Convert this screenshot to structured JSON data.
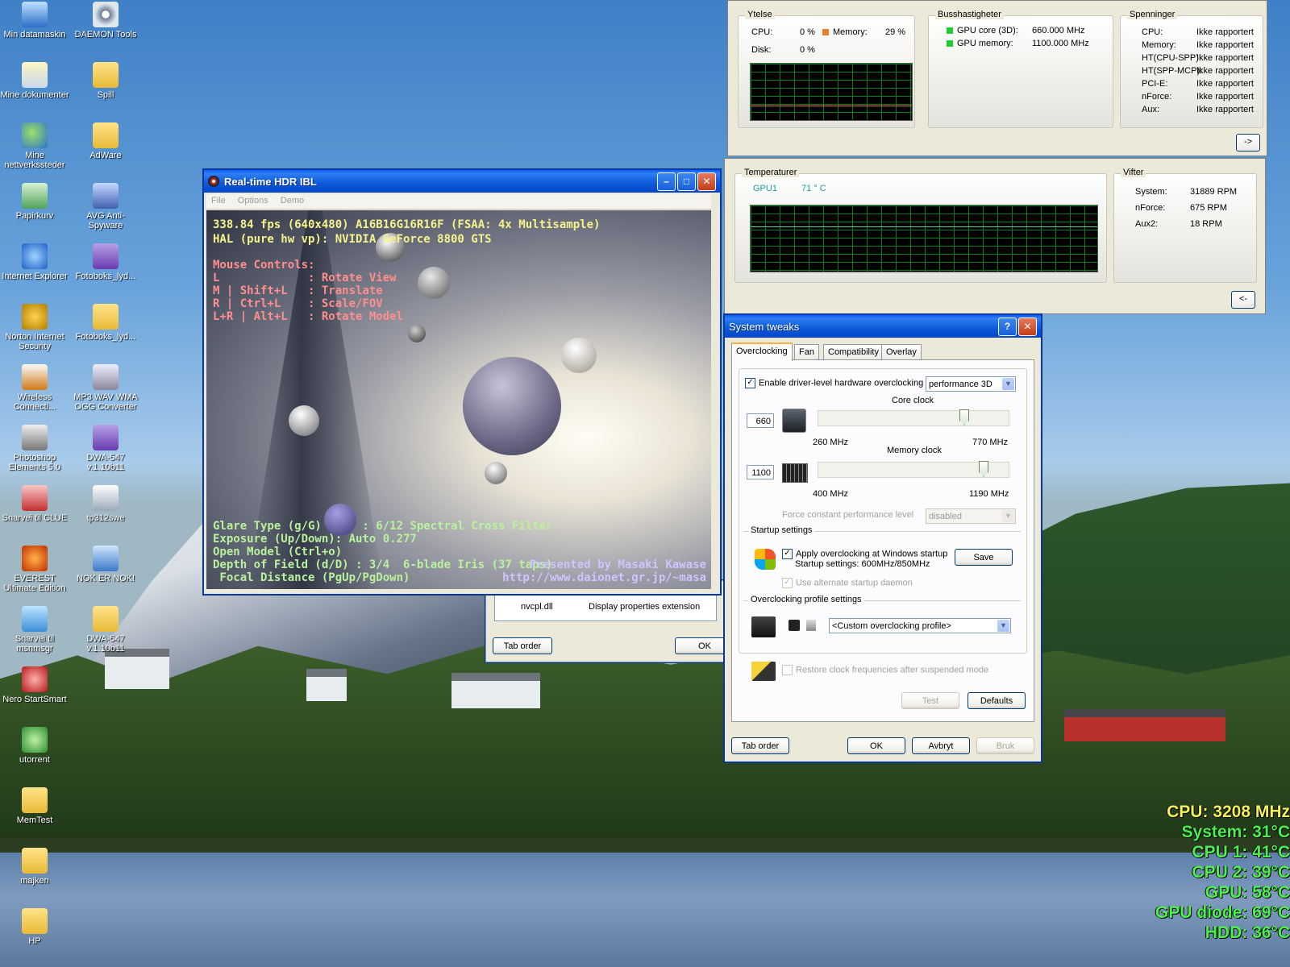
{
  "colors": {
    "xp_title_blue": "#0b59d9",
    "overlay_cpu": "#f4f15a",
    "overlay_green": "#4cf04c",
    "hdr_yellow": "#f6f28b",
    "hdr_pink": "#ff8f8f",
    "hdr_green": "#b8f29d",
    "hdr_purple": "#cfc4ff",
    "graph_green": "#0a7a1e",
    "mem_orange": "#f07b32",
    "bus_green": "#22cc33"
  },
  "desktop_icons": [
    {
      "label": "Min datamaskin",
      "icon": "computer-icon"
    },
    {
      "label": "DAEMON Tools",
      "icon": "daemon-tools-icon"
    },
    {
      "label": "Mine dokumenter",
      "icon": "documents-icon"
    },
    {
      "label": "Spill",
      "icon": "folder-icon"
    },
    {
      "label": "Mine nettverkssteder",
      "icon": "network-icon"
    },
    {
      "label": "AdWare",
      "icon": "folder-icon"
    },
    {
      "label": "Papirkurv",
      "icon": "recycle-bin-icon"
    },
    {
      "label": "AVG Anti-Spyware",
      "icon": "avg-icon"
    },
    {
      "label": "Internet Explorer",
      "icon": "ie-icon"
    },
    {
      "label": "Fotoboks_lyd...",
      "icon": "winrar-icon"
    },
    {
      "label": "Norton Internet Security",
      "icon": "norton-icon"
    },
    {
      "label": "Fotoboks_lyd...",
      "icon": "folder-icon"
    },
    {
      "label": "Wireless Connecti...",
      "icon": "dlink-icon"
    },
    {
      "label": "MP3 WAV WMA OGG Converter",
      "icon": "music-icon"
    },
    {
      "label": "Photoshop Elements 5.0",
      "icon": "camera-icon"
    },
    {
      "label": "DWA-547 v.1.10b11",
      "icon": "winrar-icon"
    },
    {
      "label": "Snarvei til CLUE",
      "icon": "book-icon"
    },
    {
      "label": "tp312swe",
      "icon": "satellite-icon"
    },
    {
      "label": "EVEREST Ultimate Edition",
      "icon": "everest-icon"
    },
    {
      "label": "NOK ER NOK!",
      "icon": "ie-shortcut-icon"
    },
    {
      "label": "Snarvei til msnmsgr",
      "icon": "msn-icon"
    },
    {
      "label": "DWA-547 v.1.10b11",
      "icon": "folder-icon"
    },
    {
      "label": "Nero StartSmart",
      "icon": "nero-icon"
    },
    {
      "label": "utorrent",
      "icon": "utorrent-icon"
    },
    {
      "label": "MemTest",
      "icon": "folder-icon"
    },
    {
      "label": "majken",
      "icon": "folder-icon"
    },
    {
      "label": "HP",
      "icon": "folder-icon"
    }
  ],
  "monitor_top": {
    "ytelse": {
      "title": "Ytelse",
      "cpu_label": "CPU:",
      "cpu_value": "0 %",
      "memory_label": "Memory:",
      "memory_value": "29 %",
      "disk_label": "Disk:",
      "disk_value": "0 %"
    },
    "buss": {
      "title": "Busshastigheter",
      "gpu_core_label": "GPU core (3D):",
      "gpu_core_value": "660.000 MHz",
      "gpu_mem_label": "GPU memory:",
      "gpu_mem_value": "1100.000 MHz"
    },
    "spenninger": {
      "title": "Spenninger",
      "rows": [
        {
          "label": "CPU:",
          "value": "Ikke rapportert"
        },
        {
          "label": "Memory:",
          "value": "Ikke rapportert"
        },
        {
          "label": "HT(CPU-SPP):",
          "value": "Ikke rapportert"
        },
        {
          "label": "HT(SPP-MCP):",
          "value": "Ikke rapportert"
        },
        {
          "label": "PCI-E:",
          "value": "Ikke rapportert"
        },
        {
          "label": "nForce:",
          "value": "Ikke rapportert"
        },
        {
          "label": "Aux:",
          "value": "Ikke rapportert"
        }
      ]
    },
    "next_button": "->"
  },
  "monitor_bottom": {
    "temperaturer": {
      "title": "Temperaturer",
      "gpu_label": "GPU1",
      "gpu_value": "71 ° C"
    },
    "vifter": {
      "title": "Vifter",
      "rows": [
        {
          "label": "System:",
          "value": "31889 RPM"
        },
        {
          "label": "nForce:",
          "value": "675 RPM"
        },
        {
          "label": "Aux2:",
          "value": "18 RPM"
        }
      ]
    },
    "prev_button": "<-"
  },
  "hdr_window": {
    "title": "Real-time HDR IBL",
    "menu": [
      "File",
      "Options",
      "Demo"
    ],
    "fps_line": "338.84 fps (640x480) A16B16G16R16F (FSAA: 4x Multisample)",
    "hal_line": "HAL (pure hw vp): NVIDIA GeForce 8800 GTS",
    "mouse_title": "Mouse Controls:",
    "mouse_lines": [
      "L             : Rotate View",
      "M | Shift+L   : Translate",
      "R | Ctrl+L    : Scale/FOV",
      "L+R | Alt+L   : Rotate Model"
    ],
    "status_lines": [
      "Glare Type (g/G)      : 6/12 Spectral Cross Filter",
      "Exposure (Up/Down): Auto 0.277",
      "Open Model (Ctrl+o)",
      "Depth of Field (d/D) : 3/4  6-blade Iris (37 taps)",
      " Focal Distance (PgUp/PgDown)"
    ],
    "credit_1": "Presented by Masaki Kawase",
    "credit_2": "http://www.daionet.gr.jp/~masa"
  },
  "behind_dialog": {
    "row_file": "nvcpl.dll",
    "row_desc": "Display properties extension",
    "tab_order": "Tab order",
    "ok": "OK"
  },
  "tweaks": {
    "title": "System tweaks",
    "tabs": [
      "Overclocking",
      "Fan",
      "Compatibility",
      "Overlay"
    ],
    "enable_label": "Enable driver-level hardware overclocking",
    "enable_checked": true,
    "mode_select": "performance 3D",
    "core": {
      "label": "Core clock",
      "value": "660",
      "min": "260 MHz",
      "max": "770 MHz",
      "level": 0.78
    },
    "memory": {
      "label": "Memory clock",
      "value": "1100",
      "min": "400 MHz",
      "max": "1190 MHz",
      "level": 0.89
    },
    "force_label": "Force constant performance level",
    "force_select": "disabled",
    "startup": {
      "title": "Startup settings",
      "apply_label": "Apply overclocking at Windows startup",
      "apply_checked": true,
      "settings_text": "Startup settings: 600MHz/850MHz",
      "save": "Save",
      "alternate_label": "Use alternate startup daemon"
    },
    "profile": {
      "title": "Overclocking profile settings",
      "select": "<Custom overclocking profile>"
    },
    "restore_label": "Restore clock frequencies after suspended mode",
    "test": "Test",
    "defaults": "Defaults",
    "tab_order": "Tab order",
    "ok": "OK",
    "cancel": "Avbryt",
    "apply": "Bruk"
  },
  "overlay": [
    {
      "text": "CPU: 3208 MHz",
      "kind": "cpu"
    },
    {
      "text": "System: 31°C",
      "kind": "green"
    },
    {
      "text": "CPU 1: 41°C",
      "kind": "green"
    },
    {
      "text": "CPU 2: 39°C",
      "kind": "green"
    },
    {
      "text": "GPU: 58°C",
      "kind": "green"
    },
    {
      "text": "GPU diode: 69°C",
      "kind": "green"
    },
    {
      "text": "HDD: 36°C",
      "kind": "green"
    }
  ]
}
